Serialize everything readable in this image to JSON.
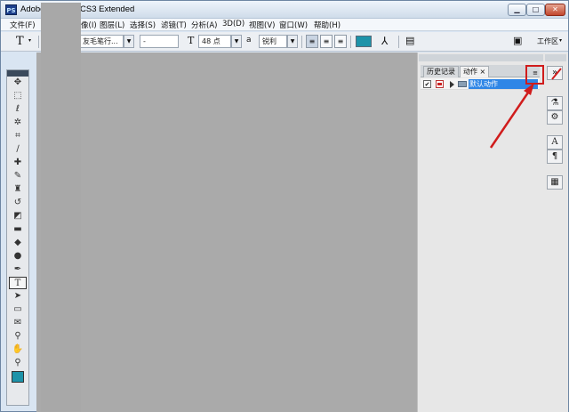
{
  "titlebar": {
    "app_icon": "PS",
    "title_left": "Adobe",
    "title_right": "CS3 Extended"
  },
  "menubar": {
    "items": [
      "文件(F)",
      "像(I)",
      "图层(L)",
      "选择(S)",
      "滤镜(T)",
      "分析(A)",
      "3D(D)",
      "视图(V)",
      "窗口(W)",
      "帮助(H)"
    ]
  },
  "options_bar": {
    "tool_letter": "T",
    "font_family": "友毛笔行...",
    "font_style": "-",
    "font_size": "48 点",
    "aa_label": "a",
    "aa_mode": "锐利",
    "workspace_label": "工作区",
    "text_color": "#1d93a9"
  },
  "panel": {
    "tabs": [
      "历史记录",
      "动作"
    ],
    "active_tab": "动作",
    "tab_close": "×",
    "menu_icon": "≡",
    "row": {
      "checked": "✔",
      "set_name": "默认动作"
    }
  },
  "toolbox": {
    "tools": [
      "move-icon",
      "marquee-icon",
      "lasso-icon",
      "magic-wand-icon",
      "crop-icon",
      "slice-icon",
      "healing-icon",
      "brush-icon",
      "stamp-icon",
      "history-brush-icon",
      "eraser-icon",
      "gradient-icon",
      "blur-icon",
      "dodge-icon",
      "pen-icon",
      "type-icon",
      "path-select-icon",
      "shape-icon",
      "notes-icon",
      "eyedropper-icon",
      "hand-icon",
      "zoom-icon"
    ],
    "foreground_color": "#1d93a9"
  },
  "annotation": {
    "color": "#d01c1c"
  }
}
